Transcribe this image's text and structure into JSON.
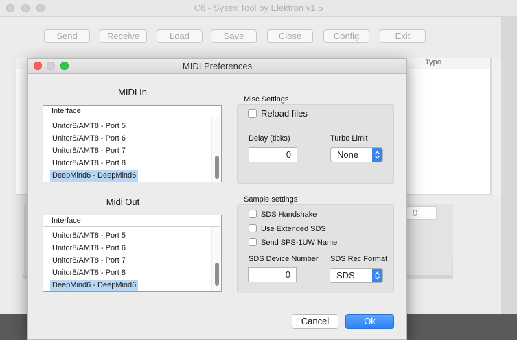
{
  "main_window": {
    "title": "C6 - Sysex Tool by Elektron v1.5",
    "toolbar": [
      "Send",
      "Receive",
      "Load",
      "Save",
      "Close",
      "Config",
      "Exit"
    ],
    "table_header_type": "Type",
    "value_field": "0"
  },
  "dialog": {
    "title": "MIDI Preferences",
    "midi_in": {
      "title": "MIDI In",
      "column_header": "Interface",
      "rows": [
        "Unitor8/AMT8 - Port 5",
        "Unitor8/AMT8 - Port 6",
        "Unitor8/AMT8 - Port 7",
        "Unitor8/AMT8 - Port 8",
        "DeepMind6 - DeepMind6"
      ],
      "selected_index": 4
    },
    "midi_out": {
      "title": "Midi Out",
      "column_header": "Interface",
      "rows": [
        "Unitor8/AMT8 - Port 5",
        "Unitor8/AMT8 - Port 6",
        "Unitor8/AMT8 - Port 7",
        "Unitor8/AMT8 - Port 8",
        "DeepMind6 - DeepMind6"
      ],
      "selected_index": 4
    },
    "misc_settings": {
      "title": "Misc Settings",
      "reload_files_label": "Reload files",
      "reload_files_checked": false,
      "delay_label": "Delay (ticks)",
      "delay_value": "0",
      "turbo_limit_label": "Turbo Limit",
      "turbo_limit_value": "None"
    },
    "sample_settings": {
      "title": "Sample settings",
      "sds_handshake_label": "SDS Handshake",
      "sds_handshake_checked": false,
      "extended_sds_label": "Use Extended SDS",
      "extended_sds_checked": false,
      "sps_name_label": "Send SPS-1UW Name",
      "sps_name_checked": false,
      "device_number_label": "SDS Device Number",
      "device_number_value": "0",
      "rec_format_label": "SDS Rec Format",
      "rec_format_value": "SDS"
    },
    "cancel_label": "Cancel",
    "ok_label": "Ok"
  },
  "colors": {
    "accent_blue": "#3b86ec",
    "selection": "#b8d7f5",
    "close_red": "#fc605c",
    "zoom_green": "#34c84a"
  }
}
